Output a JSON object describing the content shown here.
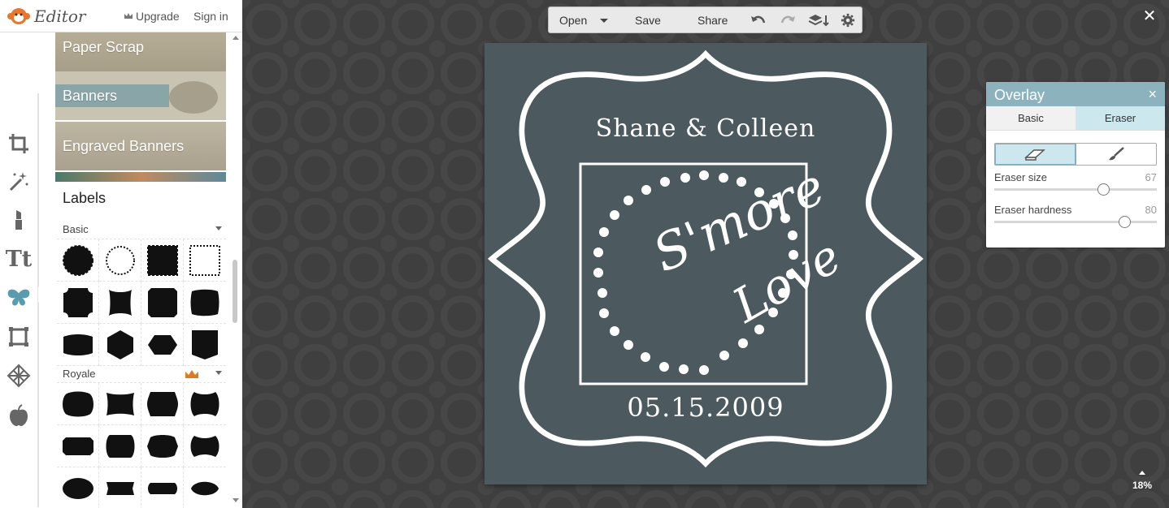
{
  "header": {
    "app_name": "Editor",
    "upgrade_label": "Upgrade",
    "signin_label": "Sign in"
  },
  "rail": {
    "items": [
      {
        "name": "crop-icon",
        "active": false
      },
      {
        "name": "magic-wand-icon",
        "active": false
      },
      {
        "name": "lipstick-icon",
        "active": false
      },
      {
        "name": "text-icon",
        "active": false
      },
      {
        "name": "butterfly-icon",
        "active": true
      },
      {
        "name": "frame-icon",
        "active": false
      },
      {
        "name": "texture-icon",
        "active": false
      },
      {
        "name": "apple-icon",
        "active": false
      }
    ],
    "text_icon_glyph": "Tt"
  },
  "library": {
    "banners": [
      {
        "label": "Paper Scrap"
      },
      {
        "label": "Banners"
      },
      {
        "label": "Engraved Banners"
      }
    ],
    "section_title": "Labels",
    "groups": [
      {
        "label": "Basic",
        "premium": false
      },
      {
        "label": "Royale",
        "premium": true
      }
    ]
  },
  "toolbar": {
    "open_label": "Open",
    "save_label": "Save",
    "share_label": "Share"
  },
  "canvas": {
    "names": "Shane & Colleen",
    "headline_1": "S'more",
    "headline_2": "Love",
    "date": "05.15.2009",
    "background_color": "#4c595e"
  },
  "overlay": {
    "title": "Overlay",
    "close_glyph": "×",
    "tabs": [
      {
        "label": "Basic",
        "active": false
      },
      {
        "label": "Eraser",
        "active": true
      }
    ],
    "modes": [
      {
        "name": "eraser-icon",
        "active": true
      },
      {
        "name": "brush-icon",
        "active": false
      }
    ],
    "eraser_size": {
      "label": "Eraser size",
      "value": 67,
      "max": 100
    },
    "eraser_hardness": {
      "label": "Eraser hardness",
      "value": 80,
      "max": 100
    },
    "accent_color": "#8cb3bd"
  },
  "zoom": {
    "value": "18%"
  },
  "window": {
    "close_glyph": "✕"
  }
}
